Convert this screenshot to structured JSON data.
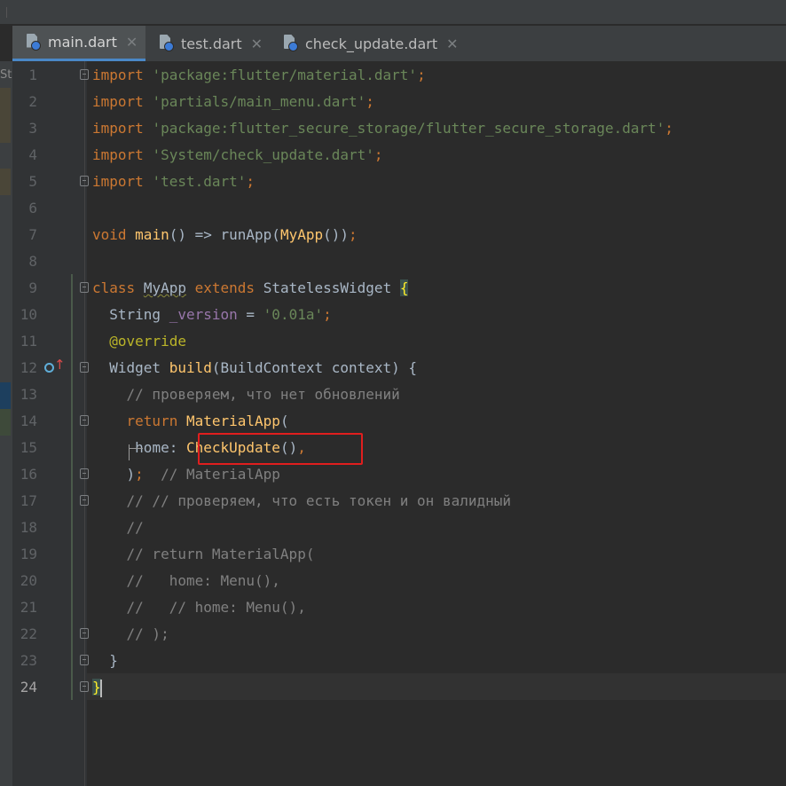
{
  "tabs": [
    {
      "label": "main.dart",
      "active": true
    },
    {
      "label": "test.dart",
      "active": false
    },
    {
      "label": "check_update.dart",
      "active": false
    }
  ],
  "tab_close_glyph": "✕",
  "left_strip_label": "St",
  "line_numbers": [
    "1",
    "2",
    "3",
    "4",
    "5",
    "6",
    "7",
    "8",
    "9",
    "10",
    "11",
    "12",
    "13",
    "14",
    "15",
    "16",
    "17",
    "18",
    "19",
    "20",
    "21",
    "22",
    "23",
    "24"
  ],
  "current_line": "24",
  "code": {
    "l1": {
      "kw": "import",
      "str": "'package:flutter/material.dart'",
      "end": ";"
    },
    "l2": {
      "kw": "import",
      "str": "'partials/main_menu.dart'",
      "end": ";"
    },
    "l3": {
      "kw": "import",
      "str": "'package:flutter_secure_storage/flutter_secure_storage.dart'",
      "end": ";"
    },
    "l4": {
      "kw": "import",
      "str": "'System/check_update.dart'",
      "end": ";"
    },
    "l5": {
      "kw": "import",
      "str": "'test.dart'",
      "end": ";"
    },
    "l7": {
      "kw": "void",
      "fn": "main",
      "rest1": "() => runApp(",
      "fn2": "MyApp",
      "rest2": "())",
      "end": ";"
    },
    "l9": {
      "kw": "class",
      "name": "MyApp",
      "kw2": "extends",
      "base": "StatelessWidget",
      "brace": "{"
    },
    "l10": {
      "type": "String",
      "var": "_version",
      "op": " = ",
      "str": "'0.01a'",
      "end": ";"
    },
    "l11": {
      "ann": "@",
      "name": "override"
    },
    "l12": {
      "type": "Widget",
      "fn": "build",
      "params": "(BuildContext context) {"
    },
    "l13": {
      "cmt": "// проверяем, что нет обновлений"
    },
    "l14": {
      "kw": "return",
      "fn": "MaterialApp",
      "rest": "("
    },
    "l15": {
      "prop": "home: ",
      "fn": "CheckUpdate",
      "rest": "()",
      "end": ","
    },
    "l16": {
      "paren": ")",
      "end": ";",
      "cmt": "  // MaterialApp"
    },
    "l17": {
      "cmt": "// // проверяем, что есть токен и он валидный"
    },
    "l18": {
      "cmt": "//"
    },
    "l19": {
      "cmt": "// return MaterialApp("
    },
    "l20": {
      "cmt": "//   home: Menu(),"
    },
    "l21": {
      "cmt": "//   // home: Menu(),"
    },
    "l22": {
      "cmt": "// );"
    },
    "l23": {
      "text": "}"
    },
    "l24": {
      "text": "}"
    }
  },
  "colors": {
    "background": "#2b2b2b",
    "keyword": "#cc7832",
    "string": "#6a8759",
    "function": "#ffc66d",
    "comment": "#808080",
    "annotation": "#bbb529",
    "highlight_box": "#e01e1e"
  },
  "icons": [
    "dart-file-icon",
    "close-icon",
    "fold-icon",
    "override-method-icon"
  ]
}
